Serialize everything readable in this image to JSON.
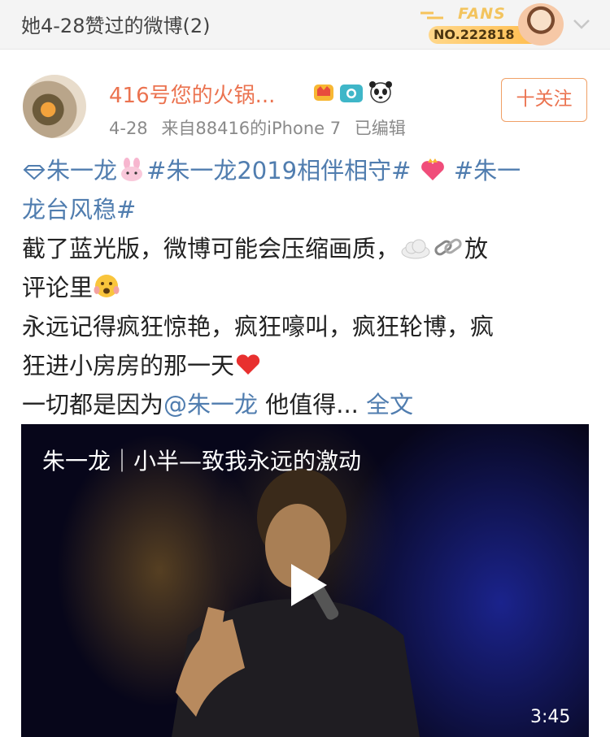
{
  "header": {
    "title": "她4-28赞过的微博(2)",
    "fans_word": "FANS",
    "fans_number": "NO.222818"
  },
  "author": {
    "name": "416号您的火锅...",
    "time": "4-28",
    "source": "来自88416的iPhone 7",
    "edited": "已编辑",
    "follow_label": "十关注"
  },
  "post": {
    "line1": {
      "topic1": "朱一龙",
      "topic2": "#朱一龙2019相伴相守#",
      "topic3_part1": "#朱一"
    },
    "line2": {
      "topic3_part2": "龙台风稳#"
    },
    "line3": {
      "text": "截了蓝光版，微博可能会压缩画质，",
      "text2": "放"
    },
    "line4": {
      "text": "评论里"
    },
    "line5": {
      "text": "永远记得疯狂惊艳，疯狂嚎叫，疯狂轮博，疯"
    },
    "line6": {
      "text": "狂进小房房的那一天"
    },
    "line7": {
      "text_before": "一切都是因为",
      "mention": "@朱一龙",
      "text_after": " 他值得... ",
      "full_text_link": "全文"
    }
  },
  "video": {
    "title": "朱一龙｜小半—致我永远的激动",
    "duration": "3:45"
  },
  "colors": {
    "accent_orange": "#eb7350",
    "link_blue": "#507daf",
    "text_dark": "#222222",
    "meta_gray": "#8a8a8a"
  }
}
